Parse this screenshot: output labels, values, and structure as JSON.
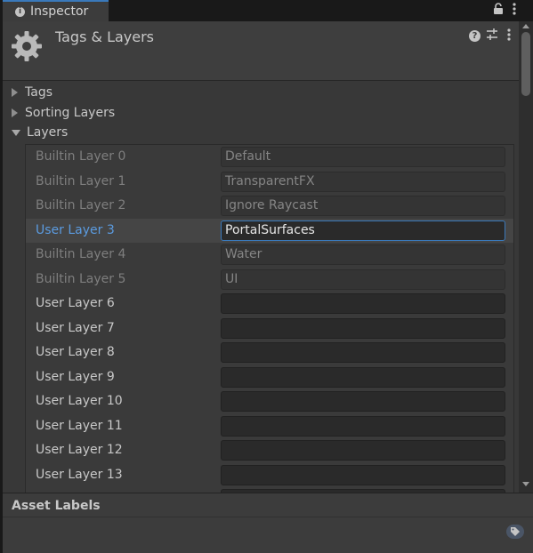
{
  "window": {
    "tab_label": "Inspector",
    "tab_icon": "info-icon",
    "lock_icon": "lock-icon",
    "menu_icon": "kebab-menu-icon"
  },
  "header": {
    "title": "Tags & Layers",
    "icon": "gear-icon",
    "help_icon": "help-icon",
    "presets_icon": "sliders-icon",
    "menu_icon": "kebab-menu-icon"
  },
  "foldouts": {
    "tags": "Tags",
    "sorting_layers": "Sorting Layers",
    "layers": "Layers"
  },
  "layers": [
    {
      "label": "Builtin Layer 0",
      "value": "Default",
      "kind": "builtin"
    },
    {
      "label": "Builtin Layer 1",
      "value": "TransparentFX",
      "kind": "builtin"
    },
    {
      "label": "Builtin Layer 2",
      "value": "Ignore Raycast",
      "kind": "builtin"
    },
    {
      "label": "User Layer 3",
      "value": "PortalSurfaces",
      "kind": "active"
    },
    {
      "label": "Builtin Layer 4",
      "value": "Water",
      "kind": "builtin"
    },
    {
      "label": "Builtin Layer 5",
      "value": "UI",
      "kind": "builtin"
    },
    {
      "label": "User Layer 6",
      "value": "",
      "kind": "user"
    },
    {
      "label": "User Layer 7",
      "value": "",
      "kind": "user"
    },
    {
      "label": "User Layer 8",
      "value": "",
      "kind": "user"
    },
    {
      "label": "User Layer 9",
      "value": "",
      "kind": "user"
    },
    {
      "label": "User Layer 10",
      "value": "",
      "kind": "user"
    },
    {
      "label": "User Layer 11",
      "value": "",
      "kind": "user"
    },
    {
      "label": "User Layer 12",
      "value": "",
      "kind": "user"
    },
    {
      "label": "User Layer 13",
      "value": "",
      "kind": "user"
    },
    {
      "label": "",
      "value": "",
      "kind": "user"
    }
  ],
  "asset_labels": {
    "title": "Asset Labels",
    "tag_icon": "tag-icon"
  },
  "colors": {
    "accent": "#3a79bb",
    "active_label": "#5b9be0"
  }
}
